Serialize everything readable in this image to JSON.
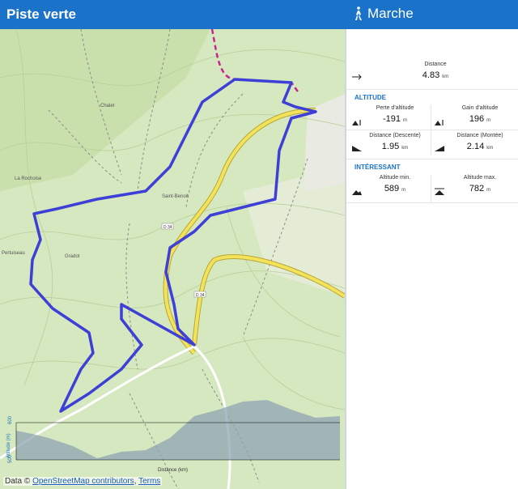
{
  "header": {
    "title": "Piste verte",
    "activity": "Marche"
  },
  "map": {
    "place_labels": [
      "Chalet",
      "La Rochoise",
      "Gradot",
      "Saint-Benoit",
      "Pertuiseau",
      "Distance (km)"
    ],
    "road_labels": [
      "D 34",
      "D 34"
    ],
    "altitude_axis_label": "Altitude (m)",
    "altitude_ticks": [
      "500",
      "600"
    ],
    "attribution_prefix": "Data © ",
    "attribution_link": "OpenStreetMap contributors",
    "attribution_sep": ", ",
    "attribution_terms": "Terms"
  },
  "stats": {
    "distance": {
      "label": "Distance",
      "value": "4.83",
      "unit": "km"
    },
    "altitude_section": "ALTITUDE",
    "descent": {
      "label": "Perte d'altitude",
      "value": "-191",
      "unit": "m"
    },
    "gain": {
      "label": "Gain d'altitude",
      "value": "196",
      "unit": "m"
    },
    "dist_descent": {
      "label": "Distance (Descente)",
      "value": "1.95",
      "unit": "km"
    },
    "dist_ascent": {
      "label": "Distance (Montée)",
      "value": "2.14",
      "unit": "km"
    },
    "interesting_section": "INTÉRESSANT",
    "alt_min": {
      "label": "Altitude min.",
      "value": "589",
      "unit": "m"
    },
    "alt_max": {
      "label": "Altitude max.",
      "value": "782",
      "unit": "m"
    }
  },
  "colors": {
    "header": "#1a73c9",
    "track": "#3d3fd6",
    "road": "#f2e35a",
    "map": "#d6e8bf",
    "elevation": "#8fa4b4"
  }
}
